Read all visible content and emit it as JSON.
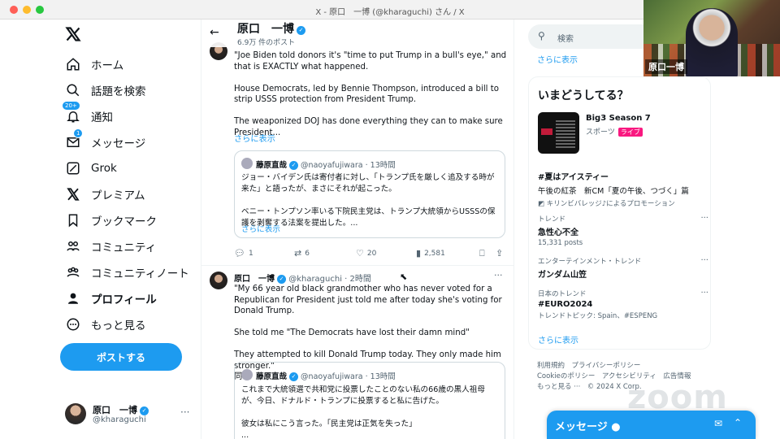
{
  "window": {
    "title": "X - 原口　一博 (@kharaguchi) さん / X"
  },
  "nav": {
    "items": [
      {
        "label": "ホーム",
        "icon": "home-icon"
      },
      {
        "label": "話題を検索",
        "icon": "search-icon"
      },
      {
        "label": "通知",
        "icon": "bell-icon",
        "badge": "20+"
      },
      {
        "label": "メッセージ",
        "icon": "mail-icon",
        "badge": "1"
      },
      {
        "label": "Grok",
        "icon": "grok-icon"
      },
      {
        "label": "プレミアム",
        "icon": "x-logo-icon"
      },
      {
        "label": "ブックマーク",
        "icon": "bookmark-icon"
      },
      {
        "label": "コミュニティ",
        "icon": "community-icon"
      },
      {
        "label": "コミュニティノート",
        "icon": "community-notes-icon"
      },
      {
        "label": "プロフィール",
        "icon": "profile-icon"
      },
      {
        "label": "もっと見る",
        "icon": "more-circle-icon"
      }
    ],
    "post_button": "ポストする",
    "account": {
      "name": "原口　一博",
      "handle": "@kharaguchi"
    }
  },
  "header": {
    "name": "原口　一博",
    "post_count": "6.9万 件のポスト"
  },
  "tweet1": {
    "text": "\"Joe Biden told donors it's \"time to put Trump in a bull's eye,\" and that is EXACTLY what happened.\n\nHouse Democrats, led by Bennie Thompson, introduced a bill to strip USSS protection from President Trump.\n\nThe weaponized DOJ has done everything they can to make sure President...",
    "show_more": "さらに表示",
    "quote": {
      "name": "藤原直哉",
      "handle": "@naoyafujiwara",
      "time": "· 13時間",
      "text": "ジョー・バイデン氏は寄付者に対し、「トランプ氏を厳しく追及する時が来た」と語ったが、まさにそれが起こった。\n\nベニー・トンプソン率いる下院民主党は、トランプ大統領からUSSSの保護を剥奪する法案を提出した。...",
      "show_more": "さらに表示"
    },
    "actions": {
      "replies": "1",
      "reposts": "6",
      "likes": "20",
      "views": "2,581"
    }
  },
  "tweet2": {
    "name": "原口　一博",
    "handle": "@kharaguchi",
    "time": "· 2時間",
    "more": "···",
    "text": "\"My 66 year old black grandmother who has never voted for a Republican for President just told me after today she's voting for Donald Trump.\n\nShe told me \"The Democrats have lost their damn mind\"\n\nThey attempted to kill Donald Trump today. They only made him stronger.\"\n同氏",
    "quote": {
      "name": "藤原直哉",
      "handle": "@naoyafujiwara",
      "time": "· 13時間",
      "text": "これまで大統領選で共和党に投票したことのない私の66歳の黒人祖母が、今日、ドナルド・トランプに投票すると私に告げた。\n\n彼女は私にこう言った。「民主党は正気を失った」\n..."
    }
  },
  "right": {
    "search_placeholder": "検索",
    "show_more": "さらに表示",
    "section_title": "いまどうしてる？",
    "live_event": {
      "title": "Big3 Season 7",
      "category": "スポーツ",
      "badge": "ライブ"
    },
    "promo": {
      "tag": "#夏はアイスティー",
      "line": "午後の紅茶　新CM「夏の午後、つづく」篇",
      "by": "キリンビバレッジ♪によるプロモーション"
    },
    "trends": [
      {
        "category": "トレンド",
        "name": "急性心不全",
        "count": "15,331 posts"
      },
      {
        "category": "エンターテインメント・トレンド",
        "name": "ガンダム山笠",
        "count": ""
      },
      {
        "category": "日本のトレンド",
        "name": "#EURO2024",
        "count": "トレンドトピック: Spain、#ESPENG"
      }
    ],
    "show_more_bottom": "さらに表示",
    "footer_lines": [
      "利用規約　プライバシーポリシー",
      "Cookieのポリシー　アクセシビリティ　広告情報",
      "もっと見る ···　© 2024 X Corp."
    ],
    "messages_label": "メッセージ"
  },
  "zoom": {
    "participant_name": "原口一博",
    "watermark": "zoom"
  },
  "colors": {
    "accent": "#1d9bf0",
    "live": "#f91880"
  }
}
